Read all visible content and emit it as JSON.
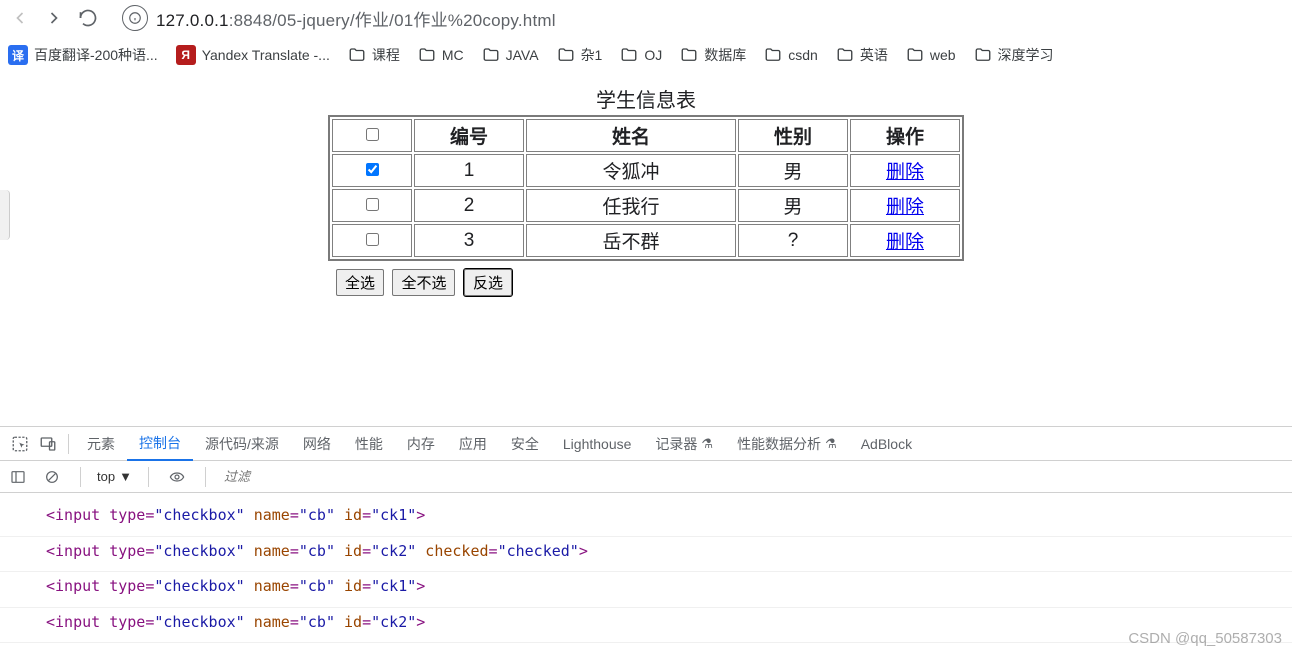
{
  "browser": {
    "url_prefix": "127.0.0.1",
    "url_rest": ":8848/05-jquery/作业/01作业%20copy.html"
  },
  "bookmarks": [
    {
      "type": "square",
      "color": "#2a6ef0",
      "text": "译",
      "label": "百度翻译-200种语..."
    },
    {
      "type": "square",
      "color": "#b51d1d",
      "text": "Я",
      "label": "Yandex Translate -..."
    },
    {
      "type": "folder",
      "label": "课程"
    },
    {
      "type": "folder",
      "label": "MC"
    },
    {
      "type": "folder",
      "label": "JAVA"
    },
    {
      "type": "folder",
      "label": "杂1"
    },
    {
      "type": "folder",
      "label": "OJ"
    },
    {
      "type": "folder",
      "label": "数据库"
    },
    {
      "type": "folder",
      "label": "csdn"
    },
    {
      "type": "folder",
      "label": "英语"
    },
    {
      "type": "folder",
      "label": "web"
    },
    {
      "type": "folder",
      "label": "深度学习"
    }
  ],
  "table": {
    "caption": "学生信息表",
    "headers": {
      "id": "编号",
      "name": "姓名",
      "gender": "性别",
      "op": "操作"
    },
    "rows": [
      {
        "checked": true,
        "id": "1",
        "name": "令狐冲",
        "gender": "男",
        "op": "删除"
      },
      {
        "checked": false,
        "id": "2",
        "name": "任我行",
        "gender": "男",
        "op": "删除"
      },
      {
        "checked": false,
        "id": "3",
        "name": "岳不群",
        "gender": "?",
        "op": "删除"
      }
    ]
  },
  "buttons": {
    "all": "全选",
    "none": "全不选",
    "invert": "反选"
  },
  "devtools": {
    "tabs": [
      "元素",
      "控制台",
      "源代码/来源",
      "网络",
      "性能",
      "内存",
      "应用",
      "安全",
      "Lighthouse",
      "记录器",
      "性能数据分析",
      "AdBlock"
    ],
    "active": 1,
    "context": "top",
    "filter_placeholder": "过滤",
    "logs": [
      "<input type=\"checkbox\" name=\"cb\" id=\"ck1\">",
      "<input type=\"checkbox\" name=\"cb\" id=\"ck2\" checked=\"checked\">",
      "<input type=\"checkbox\" name=\"cb\" id=\"ck1\">",
      "<input type=\"checkbox\" name=\"cb\" id=\"ck2\">"
    ]
  },
  "watermark": "CSDN @qq_50587303"
}
